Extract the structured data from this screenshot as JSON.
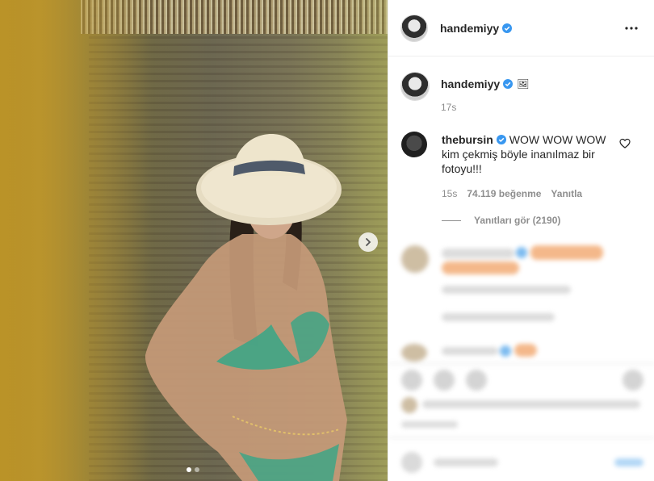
{
  "post": {
    "photo": {
      "carousel_index": 1,
      "carousel_count": 2
    },
    "author": {
      "username": "handemiyy",
      "verified": true
    },
    "caption": {
      "text": "🖼",
      "time": "17s"
    }
  },
  "comment": {
    "username": "thebursin",
    "verified": true,
    "text": "WOW WOW WOW kim çekmiş böyle inanılmaz bir fotoyu!!!",
    "time": "15s",
    "likes": "74.119 beğenme",
    "reply_label": "Yanıtla",
    "view_replies": "Yanıtları gör (2190)"
  },
  "icons": {
    "next": "chevron-right-icon",
    "more": "more-horizontal-icon",
    "like": "heart-outline-icon",
    "verified": "verified-badge-icon"
  },
  "colors": {
    "verified": "#3897f0",
    "secondary_text": "#8e8e8e",
    "border": "#efefef"
  }
}
